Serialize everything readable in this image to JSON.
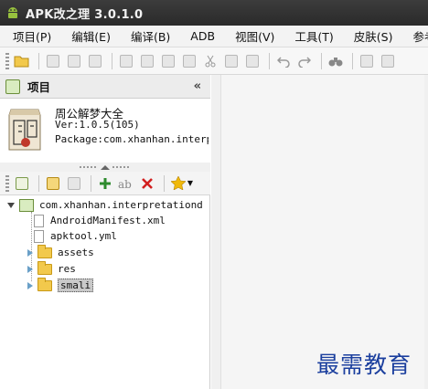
{
  "window": {
    "title": "APK改之理 3.0.1.0"
  },
  "menu": {
    "items": [
      "项目(P)",
      "编辑(E)",
      "编译(B)",
      "ADB",
      "视图(V)",
      "工具(T)",
      "皮肤(S)",
      "参考("
    ]
  },
  "panel": {
    "title": "项目",
    "collapse_glyph": "«"
  },
  "app": {
    "name": "周公解梦大全",
    "version": "Ver:1.0.5(105)",
    "package": "Package:com.xhanhan.interpretationdream"
  },
  "tree": {
    "root": "com.xhanhan.interpretationd",
    "manifest": "AndroidManifest.xml",
    "apktool": "apktool.yml",
    "assets": "assets",
    "res": "res",
    "smali": "smali"
  },
  "watermark": "最需教育",
  "colors": {
    "titlebar": "#2f2f2f",
    "watermark": "#1b3f9e",
    "selection": "#c9c9c9"
  }
}
